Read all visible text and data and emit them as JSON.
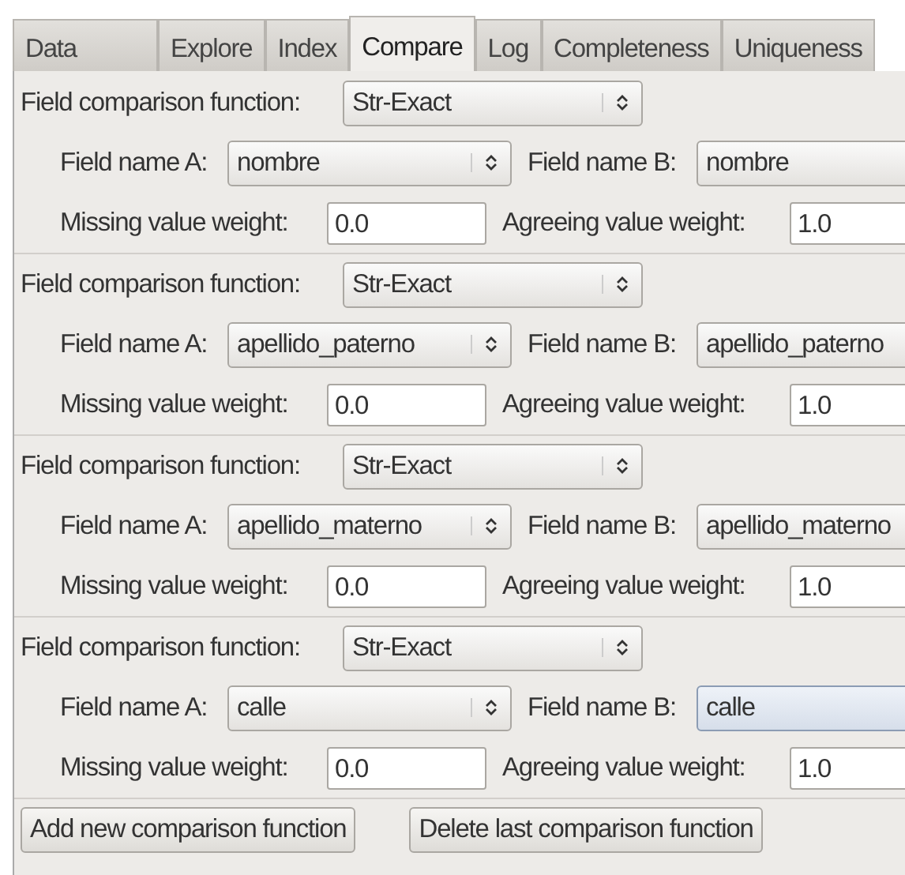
{
  "tabs": [
    {
      "label": "Data",
      "selected": false
    },
    {
      "label": "Explore",
      "selected": false
    },
    {
      "label": "Index",
      "selected": false
    },
    {
      "label": "Compare",
      "selected": true
    },
    {
      "label": "Log",
      "selected": false
    },
    {
      "label": "Completeness",
      "selected": false
    },
    {
      "label": "Uniqueness",
      "selected": false
    }
  ],
  "comparisons": [
    {
      "function_label": "Field comparison function:",
      "function": "Str-Exact",
      "field_a_label": "Field name A:",
      "field_a": "nombre",
      "field_b_label": "Field name B:",
      "field_b": "nombre",
      "field_b_focused": false,
      "missing_label": "Missing value weight:",
      "missing": "0.0",
      "agreeing_label": "Agreeing value weight:",
      "agreeing": "1.0"
    },
    {
      "function_label": "Field comparison function:",
      "function": "Str-Exact",
      "field_a_label": "Field name A:",
      "field_a": "apellido_paterno",
      "field_b_label": "Field name B:",
      "field_b": "apellido_paterno",
      "field_b_focused": false,
      "missing_label": "Missing value weight:",
      "missing": "0.0",
      "agreeing_label": "Agreeing value weight:",
      "agreeing": "1.0"
    },
    {
      "function_label": "Field comparison function:",
      "function": "Str-Exact",
      "field_a_label": "Field name A:",
      "field_a": "apellido_materno",
      "field_b_label": "Field name B:",
      "field_b": "apellido_materno",
      "field_b_focused": false,
      "missing_label": "Missing value weight:",
      "missing": "0.0",
      "agreeing_label": "Agreeing value weight:",
      "agreeing": "1.0"
    },
    {
      "function_label": "Field comparison function:",
      "function": "Str-Exact",
      "field_a_label": "Field name A:",
      "field_a": "calle",
      "field_b_label": "Field name B:",
      "field_b": "calle",
      "field_b_focused": true,
      "missing_label": "Missing value weight:",
      "missing": "0.0",
      "agreeing_label": "Agreeing value weight:",
      "agreeing": "1.0"
    }
  ],
  "buttons": [
    "Add new comparison function",
    "Delete last comparison function"
  ]
}
